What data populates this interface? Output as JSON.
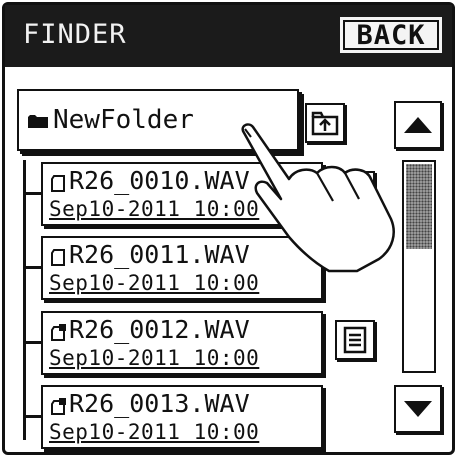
{
  "header": {
    "title": "FINDER",
    "back_label": "BACK"
  },
  "folder": {
    "name": "NewFolder",
    "icon": "folder-icon"
  },
  "files": [
    {
      "name": "R26_0010.WAV",
      "date": "Sep10-2011  10:00",
      "icon": "file-icon"
    },
    {
      "name": "R26_0011.WAV",
      "date": "Sep10-2011  10:00",
      "icon": "file-icon"
    },
    {
      "name": "R26_0012.WAV",
      "date": "Sep10-2011  10:00",
      "icon": "protected-file-icon"
    },
    {
      "name": "R26_0013.WAV",
      "date": "Sep10-2011  10:00",
      "icon": "protected-file-icon"
    }
  ],
  "controls": {
    "up_folder": "up-folder-icon",
    "file_info": "file-info-icon",
    "scroll_up": "triangle-up-icon",
    "scroll_down": "triangle-down-icon"
  }
}
